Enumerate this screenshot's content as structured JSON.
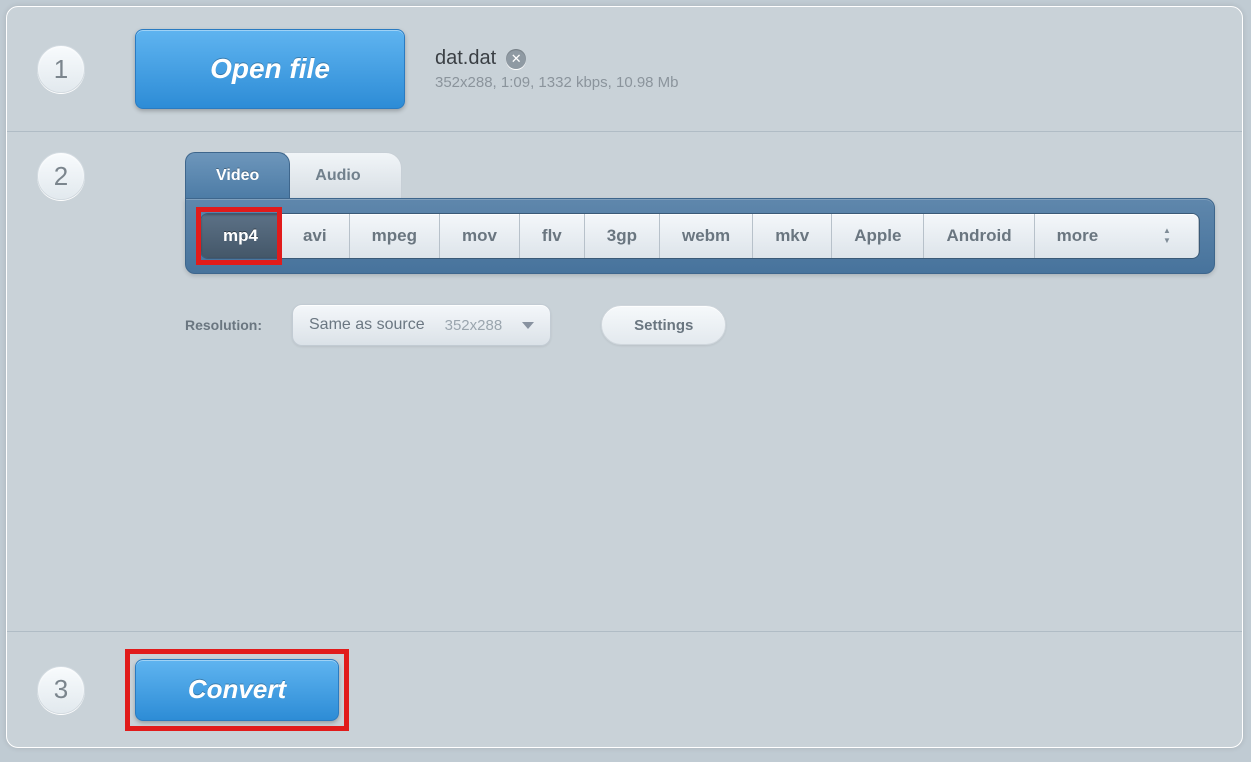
{
  "steps": {
    "one": "1",
    "two": "2",
    "three": "3"
  },
  "open_file_label": "Open file",
  "file": {
    "name": "dat.dat",
    "meta": "352x288, 1:09, 1332 kbps, 10.98 Mb"
  },
  "tabs": {
    "video": "Video",
    "audio": "Audio"
  },
  "formats": [
    "mp4",
    "avi",
    "mpeg",
    "mov",
    "flv",
    "3gp",
    "webm",
    "mkv",
    "Apple",
    "Android",
    "more"
  ],
  "selected_format_index": 0,
  "resolution": {
    "label": "Resolution:",
    "selected": "Same as source",
    "dims": "352x288"
  },
  "settings_label": "Settings",
  "convert_label": "Convert"
}
